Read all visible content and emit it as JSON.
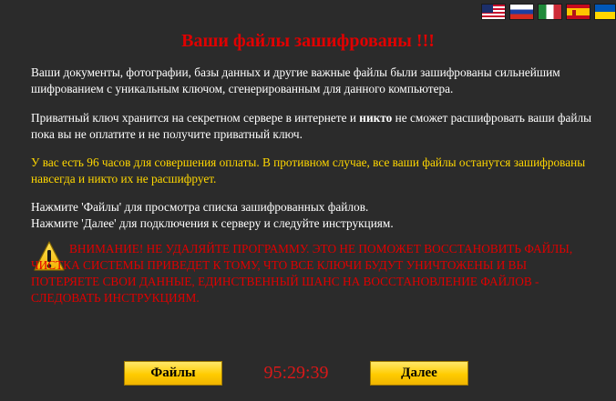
{
  "languages": [
    {
      "icon": "flag-us-icon"
    },
    {
      "icon": "flag-ru-icon"
    },
    {
      "icon": "flag-it-icon"
    },
    {
      "icon": "flag-es-icon"
    },
    {
      "icon": "flag-ua-icon"
    }
  ],
  "title": "Ваши файлы зашифрованы !!!",
  "paragraph1": "Ваши документы, фотографии, базы данных и другие важные файлы были зашифрованы сильнейшим шифрованием с уникальным ключом, сгенерированным для данного компьютера.",
  "paragraph2": {
    "before": "Приватный ключ хранится на секретном сервере в интернете и ",
    "bold": "никто",
    "after": " не сможет расшифровать ваши файлы пока вы не оплатите и не получите приватный ключ."
  },
  "paragraph3": "У вас есть 96 часов для совершения оплаты. В противном случае, все ваши файлы останутся зашифрованы навсегда и никто их не расшифрует.",
  "instructions": {
    "line1": "Нажмите 'Файлы' для просмотра списка зашифрованных файлов.",
    "line2": "Нажмите 'Далее' для подключения к серверу и следуйте инструкциям."
  },
  "warning": {
    "icon": "warning-icon",
    "text": "ВНИМАНИЕ! НЕ УДАЛЯЙТЕ ПРОГРАММУ. ЭТО НЕ ПОМОЖЕТ ВОССТАНОВИТЬ ФАЙЛЫ, ЧИСТКА СИСТЕМЫ ПРИВЕДЕТ К ТОМУ, ЧТО ВСЕ КЛЮЧИ БУДУТ УНИЧТОЖЕНЫ И ВЫ ПОТЕРЯЕТЕ СВОИ ДАННЫЕ, ЕДИНСТВЕННЫЙ ШАНС НА ВОССТАНОВЛЕНИЕ ФАЙЛОВ - СЛЕДОВАТЬ ИНСТРУКЦИЯМ."
  },
  "buttons": {
    "files": "Файлы",
    "next": "Далее"
  },
  "timer": "95:29:39",
  "colors": {
    "background": "#2b2b2b",
    "title": "#e00000",
    "text": "#ffffff",
    "highlight": "#ffd700",
    "warning": "#e00000",
    "timer": "#d81818",
    "button": "#ffcc00"
  }
}
